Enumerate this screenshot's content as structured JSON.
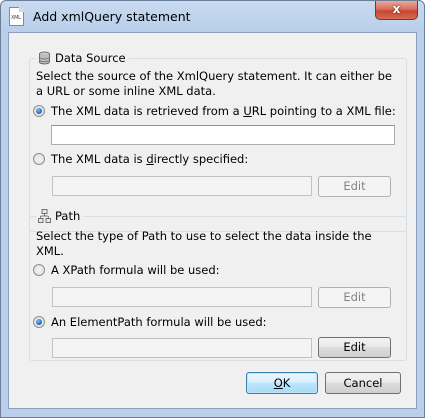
{
  "window": {
    "title": "Add xmlQuery statement",
    "icon_text": "XML",
    "close_label": "x"
  },
  "data_source": {
    "title": "Data Source",
    "icon": "database-icon",
    "description": "Select the source of the XmlQuery statement. It can either be a URL or some inline XML data.",
    "url_option": {
      "pre": "The XML data is retrieved from a ",
      "mnemonic": "U",
      "post": "RL pointing to a XML file:",
      "checked": true
    },
    "url_value": "",
    "direct_option": {
      "pre": "The XML data is ",
      "mnemonic": "d",
      "post": "irectly specified:",
      "checked": false
    },
    "direct_value": "",
    "edit_label": "Edit"
  },
  "path": {
    "title": "Path",
    "icon": "path-tree-icon",
    "description": "Select the type of Path to use to select the data inside the XML.",
    "xpath_option": {
      "label": "A XPath formula will be used:",
      "checked": false
    },
    "xpath_value": "",
    "xpath_edit_label": "Edit",
    "elementpath_option": {
      "label": "An ElementPath formula will be used:",
      "checked": true
    },
    "elementpath_value": "",
    "elementpath_edit_label": "Edit"
  },
  "footer": {
    "ok_mnemonic": "O",
    "ok_rest": "K",
    "cancel_label": "Cancel"
  }
}
